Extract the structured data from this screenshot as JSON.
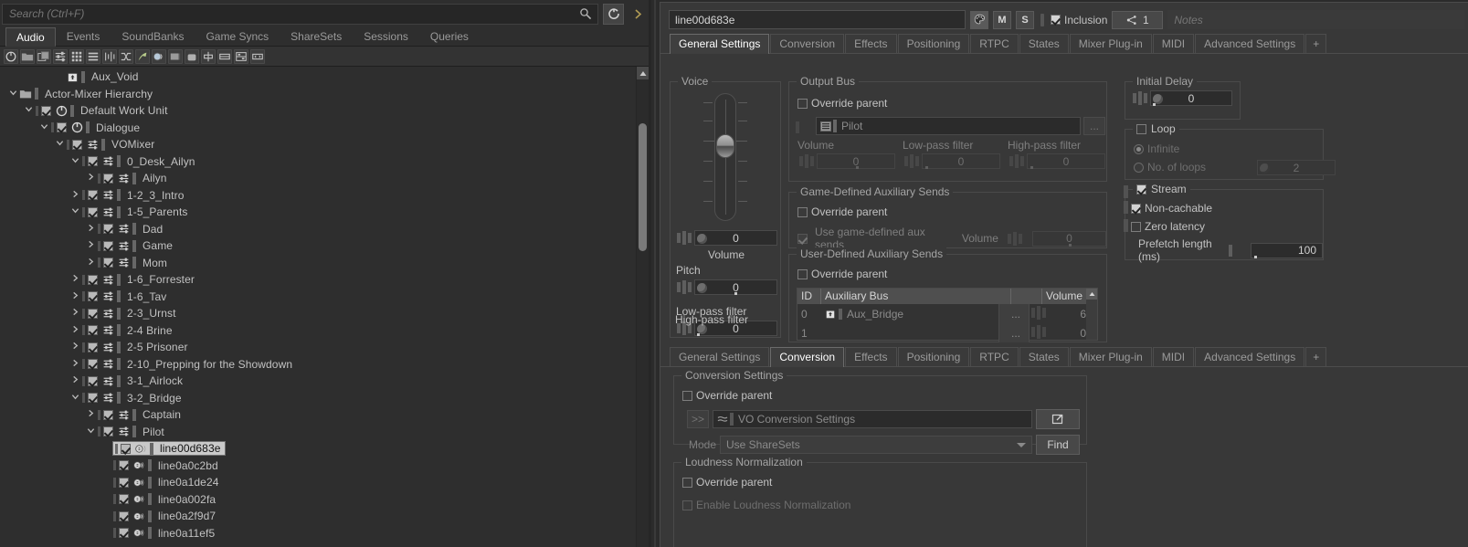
{
  "left_panel": {
    "search": {
      "placeholder": "Search (Ctrl+F)",
      "value": ""
    },
    "refresh_icon": "refresh-icon",
    "next_icon": "chevron-right-icon",
    "tabs": [
      {
        "label": "Audio",
        "active": true
      },
      {
        "label": "Events",
        "active": false
      },
      {
        "label": "SoundBanks",
        "active": false
      },
      {
        "label": "Game Syncs",
        "active": false
      },
      {
        "label": "ShareSets",
        "active": false
      },
      {
        "label": "Sessions",
        "active": false
      },
      {
        "label": "Queries",
        "active": false
      }
    ],
    "toolbar_icons": [
      "work-unit-icon",
      "folder-icon",
      "folder-new-icon",
      "actor-mixer-icon",
      "grid-icon",
      "list-icon",
      "random-container-icon",
      "switch-container-icon",
      "blend-container-icon",
      "sound-sfx-icon",
      "music-segment-icon",
      "music-track-icon",
      "music-switch-icon",
      "music-playlist-icon",
      "motion-bus-icon",
      "attenuation-icon"
    ],
    "tree": [
      {
        "label": "Aux_Void",
        "indent": 3,
        "chev": "none",
        "check": null,
        "icon": "aux-bus-icon"
      },
      {
        "label": "Actor-Mixer Hierarchy",
        "indent": 0,
        "chev": "down",
        "check": null,
        "icon": "folder-icon"
      },
      {
        "label": "Default Work Unit",
        "indent": 1,
        "chev": "down",
        "check": "on",
        "icon": "work-unit-icon"
      },
      {
        "label": "Dialogue",
        "indent": 2,
        "chev": "down",
        "check": "on",
        "icon": "work-unit-icon"
      },
      {
        "label": "VOMixer",
        "indent": 3,
        "chev": "down",
        "check": "on",
        "icon": "actor-mixer-icon"
      },
      {
        "label": "0_Desk_Ailyn",
        "indent": 4,
        "chev": "down",
        "check": "on",
        "icon": "actor-mixer-icon"
      },
      {
        "label": "Ailyn",
        "indent": 5,
        "chev": "right",
        "check": "on",
        "icon": "actor-mixer-icon"
      },
      {
        "label": "1-2_3_Intro",
        "indent": 4,
        "chev": "right",
        "check": "on",
        "icon": "actor-mixer-icon"
      },
      {
        "label": "1-5_Parents",
        "indent": 4,
        "chev": "down",
        "check": "on",
        "icon": "actor-mixer-icon"
      },
      {
        "label": "Dad",
        "indent": 5,
        "chev": "right",
        "check": "on",
        "icon": "actor-mixer-icon"
      },
      {
        "label": "Game",
        "indent": 5,
        "chev": "right",
        "check": "on",
        "icon": "actor-mixer-icon"
      },
      {
        "label": "Mom",
        "indent": 5,
        "chev": "right",
        "check": "on",
        "icon": "actor-mixer-icon"
      },
      {
        "label": "1-6_Forrester",
        "indent": 4,
        "chev": "right",
        "check": "on",
        "icon": "actor-mixer-icon"
      },
      {
        "label": "1-6_Tav",
        "indent": 4,
        "chev": "right",
        "check": "on",
        "icon": "actor-mixer-icon"
      },
      {
        "label": "2-3_Urnst",
        "indent": 4,
        "chev": "right",
        "check": "on",
        "icon": "actor-mixer-icon"
      },
      {
        "label": "2-4 Brine",
        "indent": 4,
        "chev": "right",
        "check": "on",
        "icon": "actor-mixer-icon"
      },
      {
        "label": "2-5 Prisoner",
        "indent": 4,
        "chev": "right",
        "check": "on",
        "icon": "actor-mixer-icon"
      },
      {
        "label": "2-10_Prepping for the Showdown",
        "indent": 4,
        "chev": "right",
        "check": "on",
        "icon": "actor-mixer-icon"
      },
      {
        "label": "3-1_Airlock",
        "indent": 4,
        "chev": "right",
        "check": "on",
        "icon": "actor-mixer-icon"
      },
      {
        "label": "3-2_Bridge",
        "indent": 4,
        "chev": "down",
        "check": "on",
        "icon": "actor-mixer-icon"
      },
      {
        "label": "Captain",
        "indent": 5,
        "chev": "right",
        "check": "on",
        "icon": "actor-mixer-icon"
      },
      {
        "label": "Pilot",
        "indent": 5,
        "chev": "down",
        "check": "on",
        "icon": "actor-mixer-icon"
      },
      {
        "label": "line00d683e",
        "indent": 6,
        "chev": "none",
        "check": "on",
        "icon": "sound-voice-icon",
        "selected": true
      },
      {
        "label": "line0a0c2bd",
        "indent": 6,
        "chev": "none",
        "check": "on",
        "icon": "sound-voice-icon"
      },
      {
        "label": "line0a1de24",
        "indent": 6,
        "chev": "none",
        "check": "on",
        "icon": "sound-voice-icon"
      },
      {
        "label": "line0a002fa",
        "indent": 6,
        "chev": "none",
        "check": "on",
        "icon": "sound-voice-icon"
      },
      {
        "label": "line0a2f9d7",
        "indent": 6,
        "chev": "none",
        "check": "on",
        "icon": "sound-voice-icon"
      },
      {
        "label": "line0a11ef5",
        "indent": 6,
        "chev": "none",
        "check": "on",
        "icon": "sound-voice-icon"
      }
    ]
  },
  "editor": {
    "header": {
      "object_name": "line00d683e",
      "palette_icon": "palette-icon",
      "mute_label": "M",
      "solo_label": "S",
      "inclusion_label": "Inclusion",
      "inclusion_checked": true,
      "share_icon": "share-nodes-icon",
      "share_count": "1",
      "notes_placeholder": "Notes",
      "notes_value": ""
    },
    "tabs_top": [
      {
        "label": "General Settings",
        "active": true
      },
      {
        "label": "Conversion",
        "active": false
      },
      {
        "label": "Effects",
        "active": false
      },
      {
        "label": "Positioning",
        "active": false
      },
      {
        "label": "RTPC",
        "active": false
      },
      {
        "label": "States",
        "active": false
      },
      {
        "label": "Mixer Plug-in",
        "active": false
      },
      {
        "label": "MIDI",
        "active": false
      },
      {
        "label": "Advanced Settings",
        "active": false
      },
      {
        "label": "+",
        "active": false
      }
    ],
    "tabs_bottom": [
      {
        "label": "General Settings",
        "active": false
      },
      {
        "label": "Conversion",
        "active": true
      },
      {
        "label": "Effects",
        "active": false
      },
      {
        "label": "Positioning",
        "active": false
      },
      {
        "label": "RTPC",
        "active": false
      },
      {
        "label": "States",
        "active": false
      },
      {
        "label": "Mixer Plug-in",
        "active": false
      },
      {
        "label": "MIDI",
        "active": false
      },
      {
        "label": "Advanced Settings",
        "active": false
      },
      {
        "label": "+",
        "active": false
      }
    ],
    "voice": {
      "group_title": "Voice",
      "volume_label": "Volume",
      "volume_value": "0",
      "pitch_label": "Pitch",
      "pitch_value": "0",
      "lowpass_label": "Low-pass filter",
      "lowpass_value": "0",
      "highpass_label": "High-pass filter",
      "highpass_value": "0"
    },
    "output_bus": {
      "group_title": "Output Bus",
      "override_label": "Override parent",
      "override_checked": false,
      "bus_name": "Pilot",
      "browse_label": "...",
      "volume_label": "Volume",
      "volume_value": "0",
      "lowpass_label": "Low-pass filter",
      "lowpass_value": "0",
      "highpass_label": "High-pass filter",
      "highpass_value": "0"
    },
    "game_aux": {
      "group_title": "Game-Defined Auxiliary Sends",
      "override_label": "Override parent",
      "override_checked": false,
      "use_label": "Use game-defined aux sends",
      "use_checked": true,
      "volume_label": "Volume",
      "volume_value": "0"
    },
    "user_aux": {
      "group_title": "User-Defined Auxiliary Sends",
      "override_label": "Override parent",
      "override_checked": false,
      "columns": [
        "ID",
        "Auxiliary Bus",
        "",
        "Volume"
      ],
      "rows": [
        {
          "id": "0",
          "bus": "Aux_Bridge",
          "browse": "...",
          "volume": "6"
        },
        {
          "id": "1",
          "bus": "",
          "browse": "...",
          "volume": "0"
        }
      ]
    },
    "initial_delay": {
      "group_title": "Initial Delay",
      "value": "0"
    },
    "loop": {
      "group_title": "Loop",
      "checked": false,
      "infinite_label": "Infinite",
      "infinite_selected": true,
      "no_of_loops_label": "No. of loops",
      "no_of_loops_selected": false,
      "no_of_loops_value": "2"
    },
    "stream": {
      "stream_label": "Stream",
      "stream_checked": true,
      "non_cachable_label": "Non-cachable",
      "non_cachable_checked": true,
      "zero_latency_label": "Zero latency",
      "zero_latency_checked": false,
      "prefetch_label": "Prefetch length (ms)",
      "prefetch_value": "100"
    },
    "conversion": {
      "group_title": "Conversion Settings",
      "override_label": "Override parent",
      "override_checked": false,
      "expand_label": ">>",
      "sharesets_value": "VO Conversion Settings",
      "open_icon": "open-external-icon",
      "mode_label": "Mode",
      "mode_value": "Use ShareSets",
      "find_label": "Find"
    },
    "loudness": {
      "group_title": "Loudness Normalization",
      "override_label": "Override parent",
      "override_checked": false,
      "enable_label": "Enable Loudness Normalization",
      "enable_checked": false
    }
  },
  "colors": {
    "window_bg": "#2b2b2b",
    "panel_bg": "#2e2e2e",
    "editor_bg": "#383838",
    "selection_bg": "#c9c9c9",
    "accent_gold": "#b09b54",
    "text": "#c8c8c8",
    "text_dim": "#8a8a8a"
  }
}
